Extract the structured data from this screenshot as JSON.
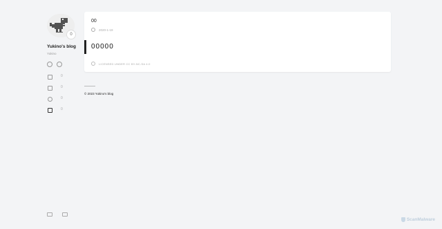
{
  "sidebar": {
    "blog_title": "Yukino's blog",
    "blog_subtitle": "Yukino",
    "avatar_badge": "0",
    "nav": [
      {
        "icon": "home-icon",
        "label": "0"
      },
      {
        "icon": "archive-icon",
        "label": "0"
      },
      {
        "icon": "search-icon",
        "label": "0"
      },
      {
        "icon": "flag-icon",
        "label": "0"
      }
    ],
    "social": [
      "github-icon",
      "google-icon"
    ],
    "footer_icons": [
      "theme-toggle-icon",
      "language-icon"
    ]
  },
  "post": {
    "title": "00",
    "date": "2020-1-19",
    "body": "00000",
    "license": "LICENSED UNDER CC BY-NC-SA 4.0"
  },
  "footer": {
    "copyright": "© 2023 Yukino's blog"
  },
  "watermark": {
    "text": "ScanMalware"
  },
  "colors": {
    "background": "#f3f4f6",
    "card": "#ffffff",
    "accent": "#222222"
  }
}
